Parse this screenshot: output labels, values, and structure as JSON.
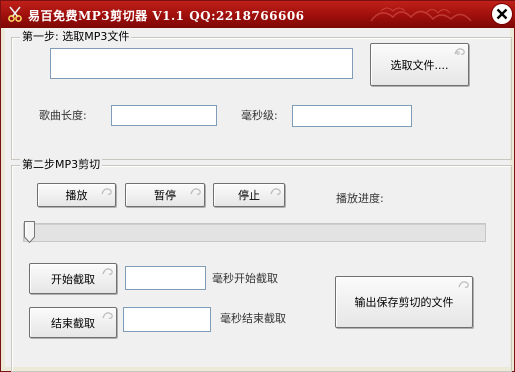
{
  "window": {
    "title": "易百免费MP3剪切器 V1.1   QQ:2218766606",
    "colors": {
      "titlebar": "#b01812",
      "client": "#f0f0f0",
      "input_border": "#7f9db9"
    }
  },
  "step1": {
    "legend": "第一步: 选取MP3文件",
    "file_path_value": "",
    "select_file_button": "选取文件....",
    "song_length_label": "歌曲长度:",
    "song_length_value": "",
    "ms_label": "毫秒级:",
    "ms_value": ""
  },
  "step2": {
    "legend": "第二步MP3剪切",
    "play_button": "播放",
    "pause_button": "暂停",
    "stop_button": "停止",
    "progress_label": "播放进度:",
    "progress_value": 0,
    "start_cut_button": "开始截取",
    "start_ms_value": "",
    "start_ms_label": "毫秒开始截取",
    "end_cut_button": "结束截取",
    "end_ms_value": "",
    "end_ms_label": "毫秒结束截取",
    "save_button": "输出保存剪切的文件"
  },
  "icons": [
    "scissors-icon",
    "close-icon",
    "swirl-icon",
    "slider-thumb-icon"
  ]
}
